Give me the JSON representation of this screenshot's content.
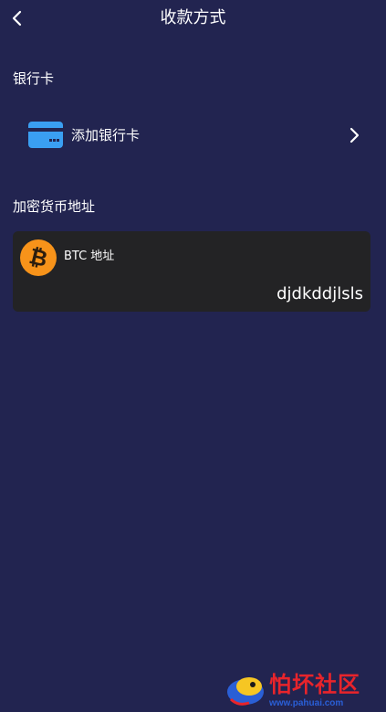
{
  "header": {
    "title": "收款方式",
    "back_icon": "chevron-left-icon"
  },
  "bank_section": {
    "label": "银行卡",
    "add_row": {
      "label": "添加银行卡",
      "icon": "credit-card-icon",
      "icon_color": "#3a9ff2",
      "chevron": "chevron-right-icon"
    }
  },
  "crypto_section": {
    "label": "加密货币地址",
    "items": [
      {
        "label": "BTC 地址",
        "address": "djdkddjlsls",
        "icon": "bitcoin-icon",
        "icon_color": "#f7931a"
      }
    ]
  },
  "watermark": {
    "title": "怕坏社区",
    "url": "www.pahuai.com"
  },
  "colors": {
    "background": "#222450",
    "card_background": "#232325",
    "text": "#ffffff"
  }
}
